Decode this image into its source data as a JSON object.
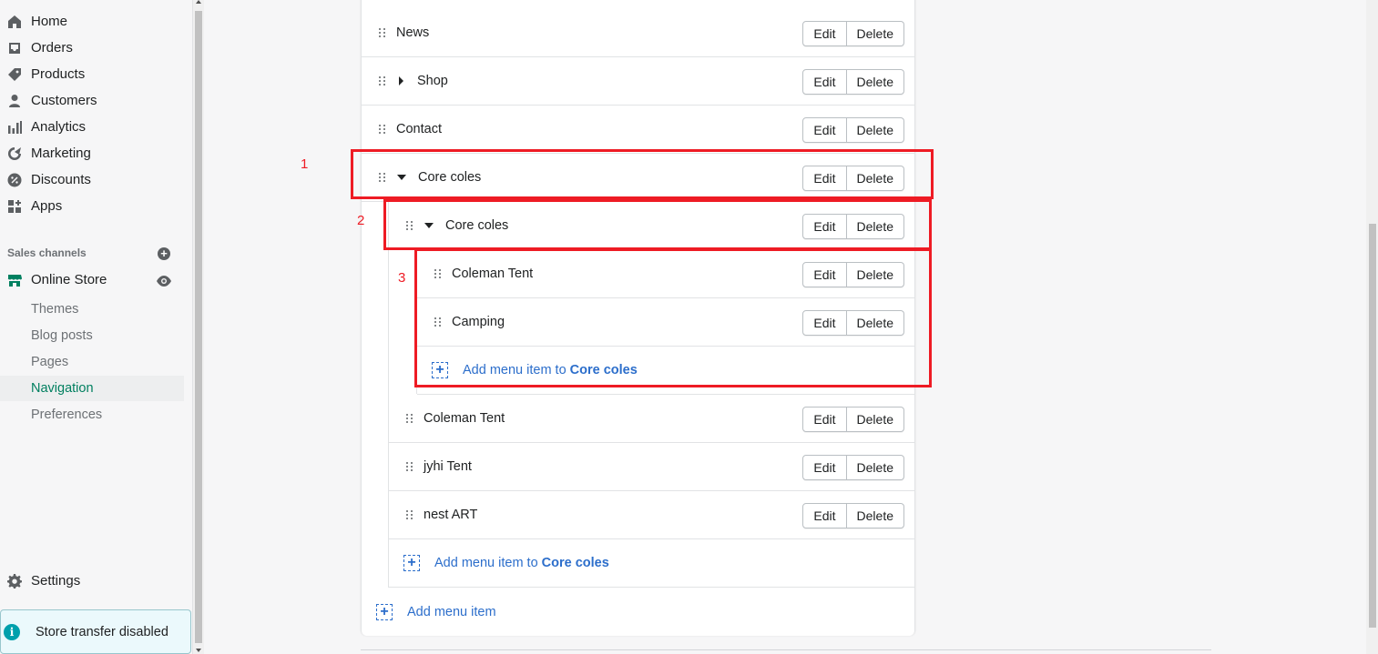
{
  "sidebar": {
    "items": [
      {
        "label": "Home",
        "icon": "home-icon"
      },
      {
        "label": "Orders",
        "icon": "orders-icon"
      },
      {
        "label": "Products",
        "icon": "tag-icon"
      },
      {
        "label": "Customers",
        "icon": "person-icon"
      },
      {
        "label": "Analytics",
        "icon": "bar-chart-icon"
      },
      {
        "label": "Marketing",
        "icon": "target-icon"
      },
      {
        "label": "Discounts",
        "icon": "discount-icon"
      },
      {
        "label": "Apps",
        "icon": "apps-icon"
      }
    ],
    "sales_channels_label": "Sales channels",
    "online_store_label": "Online Store",
    "sub_items": [
      {
        "label": "Themes"
      },
      {
        "label": "Blog posts"
      },
      {
        "label": "Pages"
      },
      {
        "label": "Navigation",
        "active": true
      },
      {
        "label": "Preferences"
      }
    ],
    "settings_label": "Settings",
    "transfer_notice": "Store transfer disabled"
  },
  "menu": {
    "edit_label": "Edit",
    "delete_label": "Delete",
    "rows": [
      {
        "label": "News"
      },
      {
        "label": "Shop",
        "caret": "right"
      },
      {
        "label": "Contact"
      },
      {
        "label": "Core coles",
        "caret": "down"
      },
      {
        "label": "Core coles",
        "caret": "down"
      },
      {
        "label": "Coleman Tent"
      },
      {
        "label": "Camping"
      },
      {
        "label": "Coleman Tent"
      },
      {
        "label": "jyhi Tent"
      },
      {
        "label": "nest ART"
      }
    ],
    "add_to_prefix": "Add menu item to ",
    "add_to_target": "Core coles",
    "add_item_label": "Add menu item"
  },
  "annotations": [
    "1",
    "2",
    "3"
  ],
  "colors": {
    "accent_link": "#2c6ecb",
    "active_nav": "#007f5f",
    "annotation_red": "#ee1b24"
  }
}
